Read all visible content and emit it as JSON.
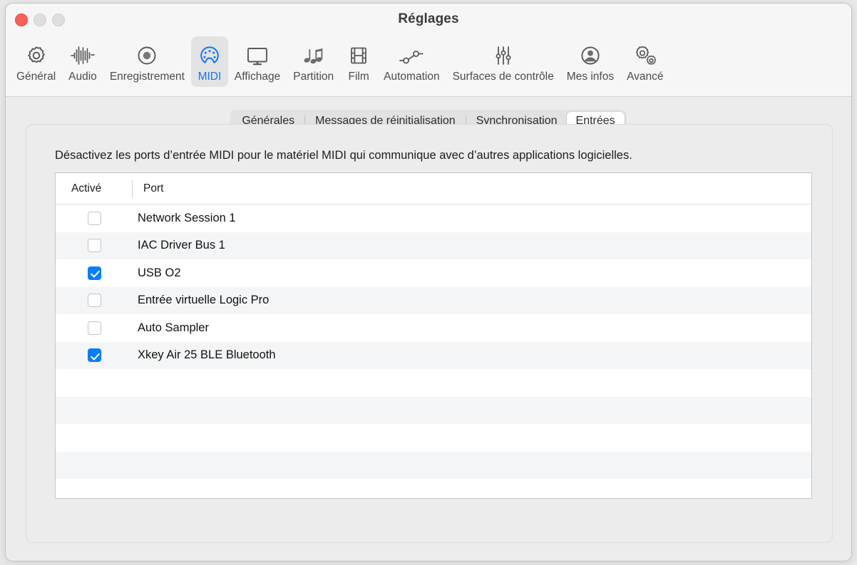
{
  "window": {
    "title": "Réglages",
    "traffic_lights": [
      {
        "name": "close",
        "color": "#fc5f57",
        "state": "active"
      },
      {
        "name": "minimize",
        "color": "#dedede",
        "state": "disabled"
      },
      {
        "name": "zoom",
        "color": "#dedede",
        "state": "disabled"
      }
    ]
  },
  "toolbar": {
    "selected": "MIDI",
    "accent_color": "#1473ff",
    "items": [
      {
        "label": "Général",
        "icon": "gear-icon"
      },
      {
        "label": "Audio",
        "icon": "waveform-icon"
      },
      {
        "label": "Enregistrement",
        "icon": "record-circle-icon"
      },
      {
        "label": "MIDI",
        "icon": "midi-connector-icon"
      },
      {
        "label": "Affichage",
        "icon": "display-monitor-icon"
      },
      {
        "label": "Partition",
        "icon": "music-notes-icon"
      },
      {
        "label": "Film",
        "icon": "film-strip-icon"
      },
      {
        "label": "Automation",
        "icon": "automation-nodes-icon"
      },
      {
        "label": "Surfaces de contrôle",
        "icon": "sliders-icon"
      },
      {
        "label": "Mes infos",
        "icon": "user-circle-icon"
      },
      {
        "label": "Avancé",
        "icon": "double-gear-icon"
      }
    ]
  },
  "tabs": {
    "selected": "Entrées",
    "items": [
      {
        "label": "Générales"
      },
      {
        "label": "Messages de réinitialisation"
      },
      {
        "label": "Synchronisation"
      },
      {
        "label": "Entrées"
      }
    ]
  },
  "panel": {
    "description": "Désactivez les ports d’entrée MIDI pour le matériel MIDI qui communique avec d’autres applications logicielles."
  },
  "table": {
    "columns": [
      "Activé",
      "Port"
    ],
    "rows": [
      {
        "enabled": false,
        "port": "Network Session 1"
      },
      {
        "enabled": false,
        "port": "IAC Driver Bus 1"
      },
      {
        "enabled": true,
        "port": "USB O2"
      },
      {
        "enabled": false,
        "port": "Entrée virtuelle Logic Pro"
      },
      {
        "enabled": false,
        "port": "Auto Sampler"
      },
      {
        "enabled": true,
        "port": "Xkey Air 25 BLE Bluetooth"
      }
    ],
    "empty_row_count": 5,
    "checkbox_on_color": "#0a7cff",
    "alt_row_color": "#f4f5f6"
  }
}
